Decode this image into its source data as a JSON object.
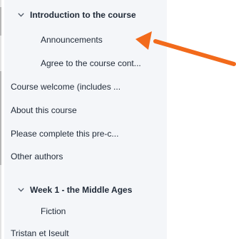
{
  "outline": {
    "section1": {
      "title": "Introduction to the course",
      "icon": "chevron-down-icon"
    },
    "items": [
      "Announcements",
      "Agree to the course cont...",
      "Course welcome (includes ...",
      "About this course",
      "Please complete this pre-c...",
      "Other authors"
    ],
    "section2": {
      "title": "Week 1 - the Middle Ages",
      "icon": "chevron-down-icon"
    },
    "items2": [
      "Fiction",
      "Tristan et Iseult"
    ]
  },
  "annotation": {
    "arrow_icon": "arrow-left-icon",
    "color": "#f26a1b"
  }
}
